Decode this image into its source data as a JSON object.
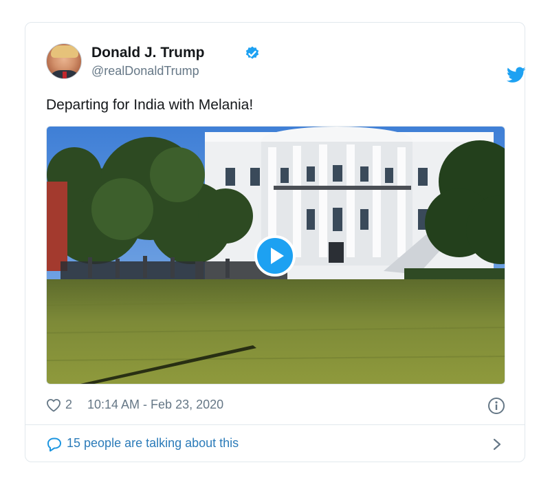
{
  "author": {
    "name": "Donald J. Trump",
    "handle": "@realDonaldTrump",
    "verified": true,
    "avatar_icon": "profile-photo"
  },
  "tweet": {
    "text": "Departing for India with Melania!",
    "media_type": "video",
    "play_icon": "play-icon"
  },
  "meta": {
    "like_icon": "heart-icon",
    "likes": "2",
    "timestamp": "10:14 AM - Feb 23, 2020",
    "info_icon": "info-icon"
  },
  "footer": {
    "talking_label": "15 people are talking about this",
    "comment_icon": "comment-icon",
    "chevron_icon": "chevron-right-icon"
  },
  "colors": {
    "twitter_blue": "#1da1f2",
    "link_blue": "#2b7bb9",
    "muted_text": "#657786",
    "border": "#e1e8ed"
  }
}
